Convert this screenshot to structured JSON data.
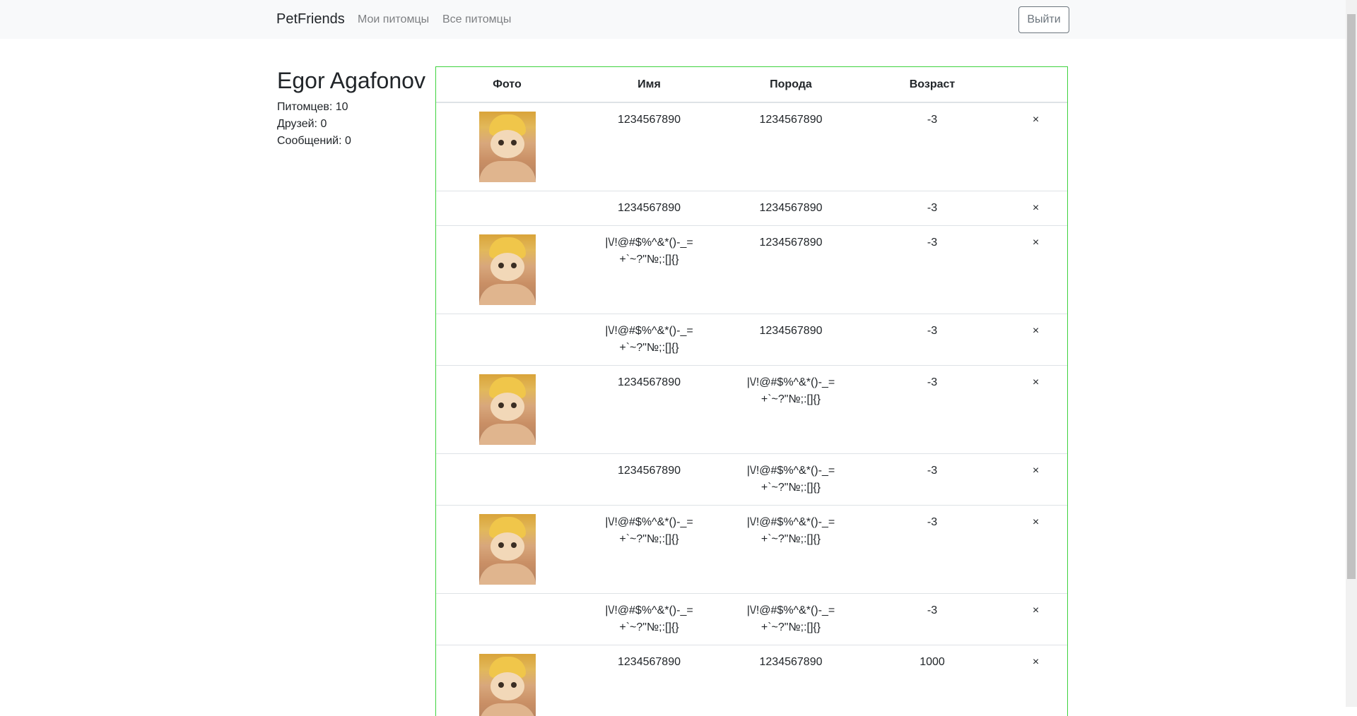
{
  "navbar": {
    "brand": "PetFriends",
    "links": [
      "Мои питомцы",
      "Все питомцы"
    ],
    "logout_label": "Выйти"
  },
  "profile": {
    "name": "Egor Agafonov",
    "stats": [
      "Питомцев: 10",
      "Друзей: 0",
      "Сообщений: 0"
    ]
  },
  "table": {
    "headers": [
      "Фото",
      "Имя",
      "Порода",
      "Возраст",
      ""
    ],
    "delete_symbol": "×",
    "rows": [
      {
        "has_photo": true,
        "name": "1234567890",
        "breed": "1234567890",
        "age": "-3"
      },
      {
        "has_photo": false,
        "name": "1234567890",
        "breed": "1234567890",
        "age": "-3"
      },
      {
        "has_photo": true,
        "name": "|\\/!@#$%^&*()-_=+`~?\"№;:[]{}",
        "breed": "1234567890",
        "age": "-3"
      },
      {
        "has_photo": false,
        "name": "|\\/!@#$%^&*()-_=+`~?\"№;:[]{}",
        "breed": "1234567890",
        "age": "-3"
      },
      {
        "has_photo": true,
        "name": "1234567890",
        "breed": "|\\/!@#$%^&*()-_=+`~?\"№;:[]{}",
        "age": "-3"
      },
      {
        "has_photo": false,
        "name": "1234567890",
        "breed": "|\\/!@#$%^&*()-_=+`~?\"№;:[]{}",
        "age": "-3"
      },
      {
        "has_photo": true,
        "name": "|\\/!@#$%^&*()-_=+`~?\"№;:[]{}",
        "breed": "|\\/!@#$%^&*()-_=+`~?\"№;:[]{}",
        "age": "-3"
      },
      {
        "has_photo": false,
        "name": "|\\/!@#$%^&*()-_=+`~?\"№;:[]{}",
        "breed": "|\\/!@#$%^&*()-_=+`~?\"№;:[]{}",
        "age": "-3"
      },
      {
        "has_photo": true,
        "name": "1234567890",
        "breed": "1234567890",
        "age": "1000"
      }
    ]
  }
}
